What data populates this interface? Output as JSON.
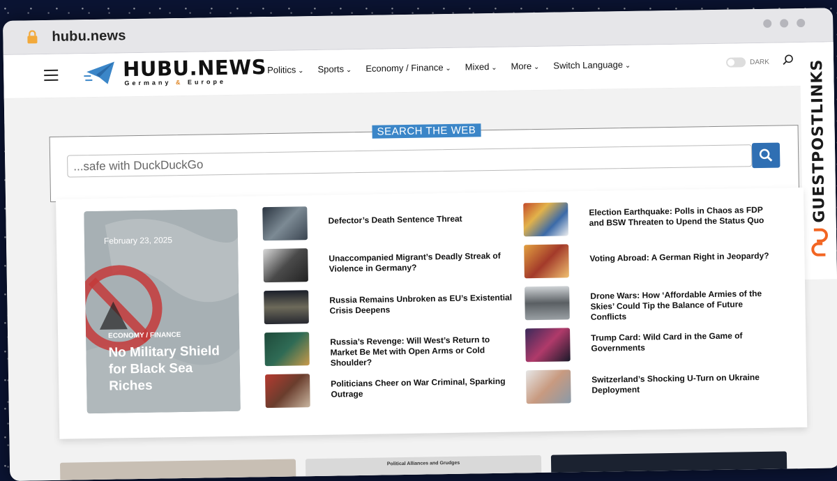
{
  "browser": {
    "url": "hubu.news"
  },
  "header": {
    "logo_title": "HUBU.NEWS",
    "logo_sub_1": "Germany",
    "logo_sub_amp": "&",
    "logo_sub_2": "Europe",
    "nav": [
      "Politics",
      "Sports",
      "Economy / Finance",
      "Mixed",
      "More",
      "Switch Language"
    ],
    "dark_label": "DARK"
  },
  "side_banner": {
    "text": "GUESTPOSTLINKS"
  },
  "search": {
    "label": "SEARCH THE WEB",
    "placeholder": "...safe with DuckDuckGo"
  },
  "feature": {
    "date": "February 23, 2025",
    "category": "ECONOMY / FINANCE",
    "title": "No Military Shield for Black Sea Riches"
  },
  "articles_left": [
    {
      "title": "Defector’s Death Sentence Threat"
    },
    {
      "title": "Unaccompanied Migrant’s Deadly Streak of Violence in Germany?"
    },
    {
      "title": "Russia Remains Unbroken as EU’s Existential Crisis Deepens"
    },
    {
      "title": "Russia’s Revenge: Will West’s Return to Market Be Met with Open Arms or Cold Shoulder?"
    },
    {
      "title": "Politicians Cheer on War Criminal, Sparking Outrage"
    }
  ],
  "articles_right": [
    {
      "title": "Election Earthquake: Polls in Chaos as FDP and BSW Threaten to Upend the Status Quo"
    },
    {
      "title": "Voting Abroad: A German Right in Jeopardy?"
    },
    {
      "title": "Drone Wars: How ‘Affordable Armies of the Skies’ Could Tip the Balance of Future Conflicts"
    },
    {
      "title": "Trump Card: Wild Card in the Game of Governments"
    },
    {
      "title": "Switzerland’s Shocking U-Turn on Ukraine Deployment"
    }
  ],
  "cards": {
    "card2_caption": "Political Alliances and Grudges"
  },
  "colors": {
    "accent": "#3b86c8",
    "search_button": "#2f6fb3",
    "logo_amp": "#e08a2c"
  }
}
